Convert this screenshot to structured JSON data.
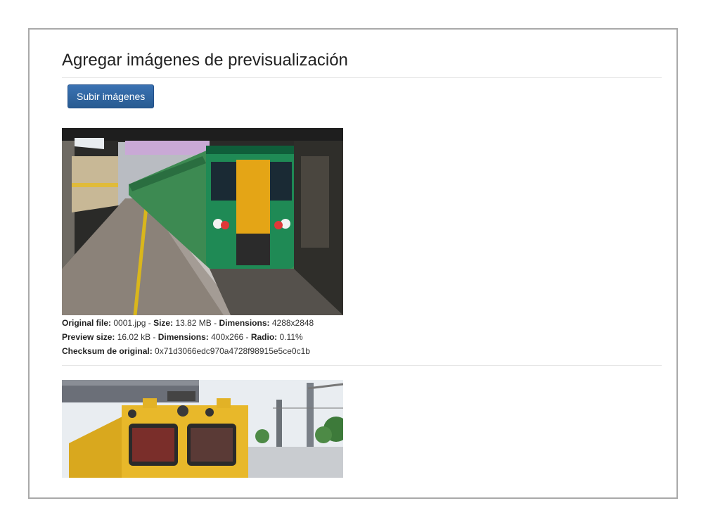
{
  "page": {
    "title": "Agregar imágenes de previsualización",
    "upload_label": "Subir imágenes"
  },
  "previews": [
    {
      "original_file_label": "Original file:",
      "original_file": "0001.jpg",
      "size_label": "Size:",
      "size": "13.82 MB",
      "dimensions_label": "Dimensions:",
      "dimensions": "4288x2848",
      "preview_size_label": "Preview size:",
      "preview_size": "16.02 kB",
      "preview_dimensions_label": "Dimensions:",
      "preview_dimensions": "400x266",
      "ratio_label": "Radio:",
      "ratio": "0.11%",
      "checksum_label": "Checksum de original:",
      "checksum": "0x71d3066edc970a4728f98915e5ce0c1b"
    }
  ],
  "colors": {
    "button": "#31639c",
    "frame_border": "#a9a9a9"
  }
}
